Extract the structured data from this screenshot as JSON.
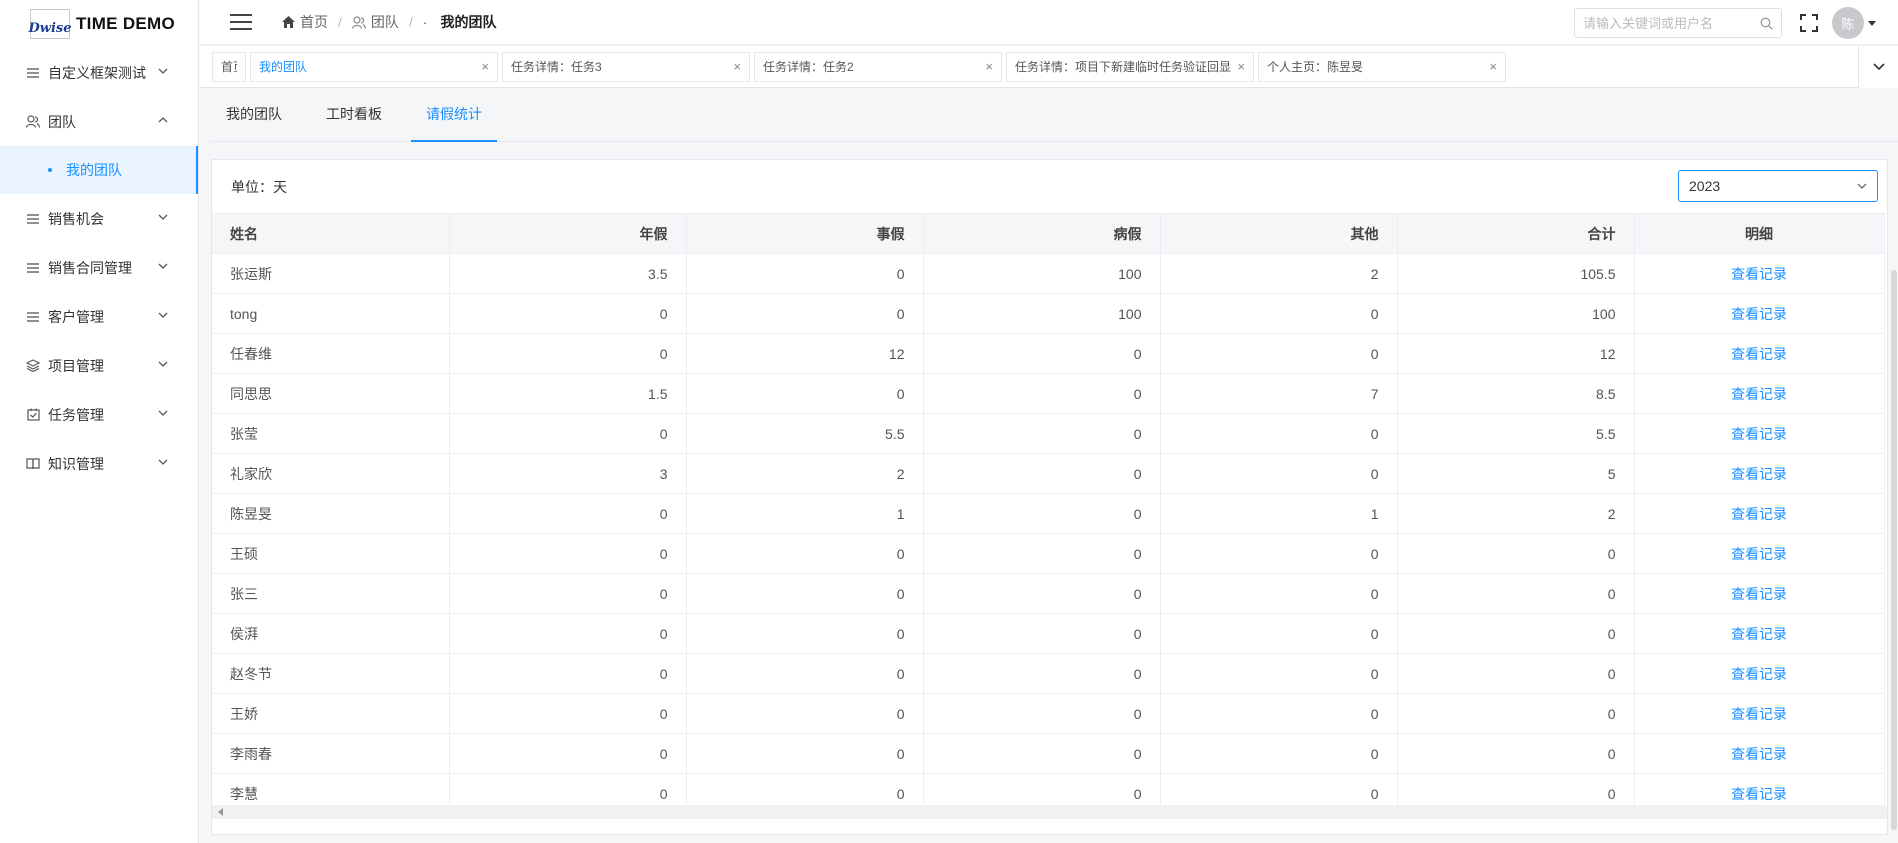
{
  "app": {
    "logo_mark": "Dwise",
    "title": "TIME DEMO"
  },
  "sidebar": {
    "items": [
      {
        "label": "自定义框架测试",
        "icon": "list-icon",
        "expanded": false
      },
      {
        "label": "团队",
        "icon": "team-icon",
        "expanded": true
      },
      {
        "label": "销售机会",
        "icon": "list-icon",
        "expanded": false
      },
      {
        "label": "销售合同管理",
        "icon": "list-icon",
        "expanded": false
      },
      {
        "label": "客户管理",
        "icon": "list-icon",
        "expanded": false
      },
      {
        "label": "项目管理",
        "icon": "layers-icon",
        "expanded": false
      },
      {
        "label": "任务管理",
        "icon": "checkbox-icon",
        "expanded": false
      },
      {
        "label": "知识管理",
        "icon": "book-icon",
        "expanded": false
      }
    ],
    "submenu": {
      "label": "我的团队"
    }
  },
  "header": {
    "breadcrumb": [
      "首页",
      "团队",
      "我的团队"
    ],
    "search_placeholder": "请输入关键词或用户名",
    "avatar_text": "陈"
  },
  "tags": [
    {
      "label": "首页",
      "closable": false,
      "active": false
    },
    {
      "label": "我的团队",
      "closable": true,
      "active": true
    },
    {
      "label": "任务详情：任务3",
      "closable": true,
      "active": false
    },
    {
      "label": "任务详情：任务2",
      "closable": true,
      "active": false
    },
    {
      "label": "任务详情：项目下新建临时任务验证回显",
      "closable": true,
      "active": false
    },
    {
      "label": "个人主页：陈昱旻",
      "closable": true,
      "active": false
    }
  ],
  "tabs": [
    {
      "label": "我的团队",
      "active": false
    },
    {
      "label": "工时看板",
      "active": false
    },
    {
      "label": "请假统计",
      "active": true
    }
  ],
  "panel": {
    "unit_label": "单位：天",
    "year": "2023"
  },
  "table": {
    "columns": [
      "姓名",
      "年假",
      "事假",
      "病假",
      "其他",
      "合计",
      "明细"
    ],
    "action_label": "查看记录",
    "rows": [
      [
        "张运斯",
        "3.5",
        "0",
        "100",
        "2",
        "105.5"
      ],
      [
        "tong",
        "0",
        "0",
        "100",
        "0",
        "100"
      ],
      [
        "任春维",
        "0",
        "12",
        "0",
        "0",
        "12"
      ],
      [
        "同思思",
        "1.5",
        "0",
        "0",
        "7",
        "8.5"
      ],
      [
        "张莹",
        "0",
        "5.5",
        "0",
        "0",
        "5.5"
      ],
      [
        "礼家欣",
        "3",
        "2",
        "0",
        "0",
        "5"
      ],
      [
        "陈昱旻",
        "0",
        "1",
        "0",
        "1",
        "2"
      ],
      [
        "王硕",
        "0",
        "0",
        "0",
        "0",
        "0"
      ],
      [
        "张三",
        "0",
        "0",
        "0",
        "0",
        "0"
      ],
      [
        "侯湃",
        "0",
        "0",
        "0",
        "0",
        "0"
      ],
      [
        "赵冬节",
        "0",
        "0",
        "0",
        "0",
        "0"
      ],
      [
        "王娇",
        "0",
        "0",
        "0",
        "0",
        "0"
      ],
      [
        "李雨春",
        "0",
        "0",
        "0",
        "0",
        "0"
      ],
      [
        "李慧",
        "0",
        "0",
        "0",
        "0",
        "0"
      ]
    ]
  },
  "colors": {
    "accent": "#1890ff"
  }
}
